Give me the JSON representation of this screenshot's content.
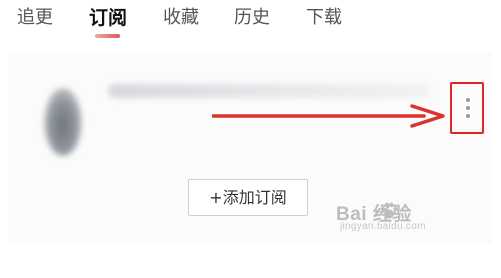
{
  "tabs": [
    {
      "label": "追更",
      "active": false
    },
    {
      "label": "订阅",
      "active": true
    },
    {
      "label": "收藏",
      "active": false
    },
    {
      "label": "历史",
      "active": false
    },
    {
      "label": "下载",
      "active": false
    }
  ],
  "subscription": {
    "add_button_label": "+添加订阅",
    "more_icon": "more-vertical-icon"
  },
  "annotation": {
    "color": "#d9342b",
    "highlight_color": "#e0261d"
  },
  "watermark": {
    "brand": "Bai  经验",
    "url": "jingyan.baidu.com"
  }
}
